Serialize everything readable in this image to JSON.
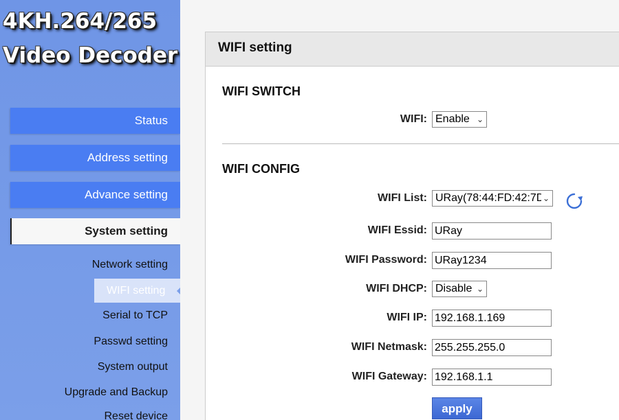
{
  "brand": {
    "line1": "4KH.264/265",
    "line2": "Video Decoder"
  },
  "nav": {
    "status": "Status",
    "address": "Address setting",
    "advance": "Advance setting",
    "system": "System setting"
  },
  "subnav": {
    "network": "Network setting",
    "wifi": "WIFI setting",
    "serial": "Serial to TCP",
    "passwd": "Passwd setting",
    "output": "System output",
    "upgrade": "Upgrade and Backup",
    "reset": "Reset device"
  },
  "panel": {
    "title": "WIFI setting"
  },
  "switch_section": {
    "title": "WIFI SWITCH",
    "wifi_label": "WIFI:",
    "wifi_value": "Enable"
  },
  "config_section": {
    "title": "WIFI CONFIG",
    "list_label": "WIFI List:",
    "list_value": "URay(78:44:FD:42:7D",
    "essid_label": "WIFI Essid:",
    "essid_value": "URay",
    "password_label": "WIFI Password:",
    "password_value": "URay1234",
    "dhcp_label": "WIFI DHCP:",
    "dhcp_value": "Disable",
    "ip_label": "WIFI IP:",
    "ip_value": "192.168.1.169",
    "netmask_label": "WIFI Netmask:",
    "netmask_value": "255.255.255.0",
    "gateway_label": "WIFI Gateway:",
    "gateway_value": "192.168.1.1",
    "apply_label": "apply"
  },
  "colors": {
    "sidebar": "#7b9fe9",
    "nav_button": "#4a7df2",
    "apply_button": "#3d68d3",
    "refresh_icon": "#3b6fd6"
  },
  "icons": {
    "refresh": "refresh-icon",
    "dropdown": "chevron-down-icon"
  }
}
